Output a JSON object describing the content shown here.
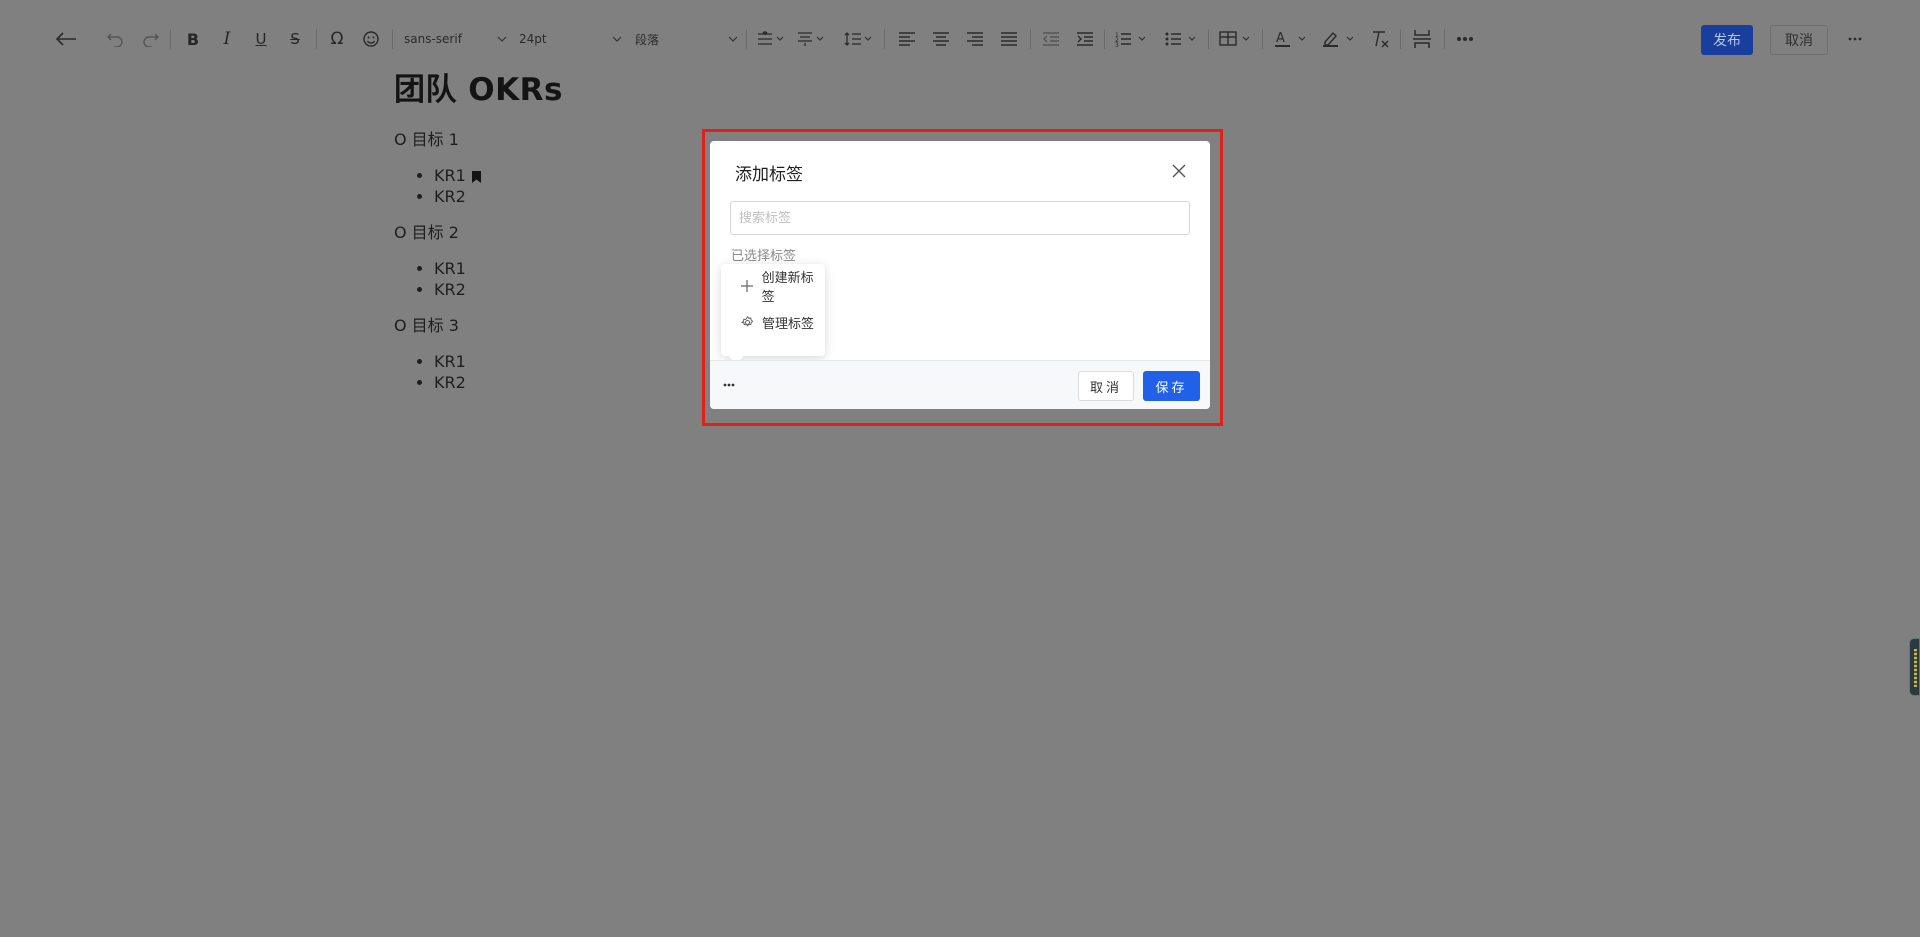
{
  "toolbar": {
    "font_family": "sans-serif",
    "font_size": "24pt",
    "paragraph_style": "段落",
    "publish_label": "发布",
    "cancel_label": "取消",
    "icons": [
      "back-arrow-icon",
      "undo-icon",
      "redo-icon",
      "bold-icon",
      "italic-icon",
      "underline-icon",
      "strikethrough-icon",
      "omega-icon",
      "emoji-icon",
      "vertical-align-icon",
      "paragraph-spacing-icon",
      "line-height-icon",
      "align-left-icon",
      "align-center-icon",
      "align-right-icon",
      "justify-icon",
      "outdent-icon",
      "indent-icon",
      "ordered-list-icon",
      "bullet-list-icon",
      "table-icon",
      "text-color-icon",
      "highlight-icon",
      "clear-format-icon",
      "page-break-icon",
      "more-icon"
    ]
  },
  "document": {
    "title": "团队 OKRs",
    "objectives": [
      {
        "label": "O 目标 1",
        "krs": [
          "KR1",
          "KR2"
        ]
      },
      {
        "label": "O 目标 2",
        "krs": [
          "KR1",
          "KR2"
        ]
      },
      {
        "label": "O 目标 3",
        "krs": [
          "KR1",
          "KR2"
        ]
      }
    ]
  },
  "modal": {
    "title": "添加标签",
    "search_placeholder": "搜索标签",
    "selected_label": "已选择标签",
    "cancel_label": "取消",
    "save_label": "保存",
    "popover": {
      "create_label": "创建新标签",
      "manage_label": "管理标签"
    }
  },
  "colors": {
    "overlay": "#808080",
    "primary": "#2160e8",
    "highlight_border": "#e0201a"
  }
}
